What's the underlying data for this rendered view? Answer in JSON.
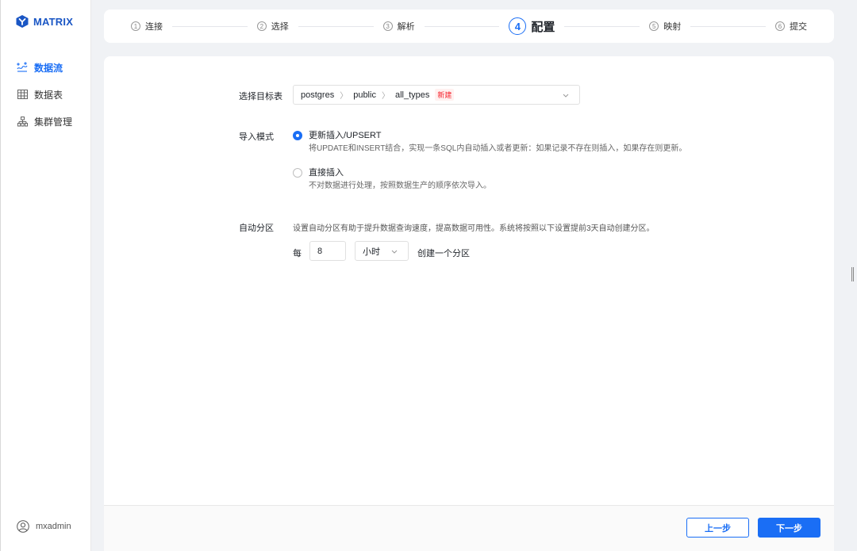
{
  "brand": {
    "name": "MATRIX",
    "color": "#1a56c4",
    "accent": "#1a6ef5"
  },
  "sidebar": {
    "items": [
      {
        "label": "数据流",
        "icon": "dataflow-icon",
        "active": true
      },
      {
        "label": "数据表",
        "icon": "table-icon",
        "active": false
      },
      {
        "label": "集群管理",
        "icon": "cluster-icon",
        "active": false
      }
    ],
    "user": {
      "name": "mxadmin",
      "icon": "user-icon"
    }
  },
  "steps": [
    {
      "num": "1",
      "label": "连接",
      "active": false
    },
    {
      "num": "2",
      "label": "选择",
      "active": false
    },
    {
      "num": "3",
      "label": "解析",
      "active": false
    },
    {
      "num": "4",
      "label": "配置",
      "active": true
    },
    {
      "num": "5",
      "label": "映射",
      "active": false
    },
    {
      "num": "6",
      "label": "提交",
      "active": false
    }
  ],
  "form": {
    "target_label": "选择目标表",
    "target_path": [
      "postgres",
      "public",
      "all_types"
    ],
    "target_tag": "新建",
    "import_label": "导入模式",
    "import_options": [
      {
        "title": "更新插入/UPSERT",
        "desc": "将UPDATE和INSERT结合，实现一条SQL内自动插入或者更新：如果记录不存在则插入，如果存在则更新。",
        "checked": true
      },
      {
        "title": "直接插入",
        "desc": "不对数据进行处理，按照数据生产的顺序依次导入。",
        "checked": false
      }
    ],
    "partition_label": "自动分区",
    "partition_desc": "设置自动分区有助于提升数据查询速度，提高数据可用性。系统将按照以下设置提前3天自动创建分区。",
    "every_label": "每",
    "interval_value": "8",
    "interval_unit": "小时",
    "create_label": "创建一个分区"
  },
  "footer": {
    "prev_label": "上一步",
    "next_label": "下一步"
  }
}
